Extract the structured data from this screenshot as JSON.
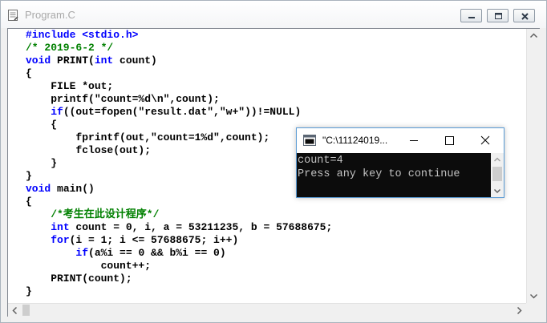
{
  "editor": {
    "title": "Program.C",
    "title_icon": "document-icon",
    "code_lines": [
      [
        {
          "t": "#include <stdio.h>",
          "c": "pp"
        }
      ],
      [
        {
          "t": "/* 2019-6-2 */",
          "c": "cm"
        }
      ],
      [
        {
          "t": "void",
          "c": "kw"
        },
        {
          "t": " PRINT(",
          "c": "tx"
        },
        {
          "t": "int",
          "c": "kw"
        },
        {
          "t": " count)",
          "c": "tx"
        }
      ],
      [
        {
          "t": "{",
          "c": "tx"
        }
      ],
      [
        {
          "t": "    FILE *out;",
          "c": "tx"
        }
      ],
      [
        {
          "t": "    printf(\"count=%d\\n\",count);",
          "c": "tx"
        }
      ],
      [
        {
          "t": "    ",
          "c": "tx"
        },
        {
          "t": "if",
          "c": "kw"
        },
        {
          "t": "((out=fopen(\"result.dat\",\"w+\"))!=NULL)",
          "c": "tx"
        }
      ],
      [
        {
          "t": "    {",
          "c": "tx"
        }
      ],
      [
        {
          "t": "        fprintf(out,\"count=1%d\",count);",
          "c": "tx"
        }
      ],
      [
        {
          "t": "        fclose(out);",
          "c": "tx"
        }
      ],
      [
        {
          "t": "    }",
          "c": "tx"
        }
      ],
      [
        {
          "t": "}",
          "c": "tx"
        }
      ],
      [
        {
          "t": "void",
          "c": "kw"
        },
        {
          "t": " main()",
          "c": "tx"
        }
      ],
      [
        {
          "t": "{",
          "c": "tx"
        }
      ],
      [
        {
          "t": "    /*考生在此设计程序*/",
          "c": "cm"
        }
      ],
      [
        {
          "t": "    ",
          "c": "tx"
        },
        {
          "t": "int",
          "c": "kw"
        },
        {
          "t": " count = 0, i, a = 53211235, b = 57688675;",
          "c": "tx"
        }
      ],
      [
        {
          "t": "    ",
          "c": "tx"
        },
        {
          "t": "for",
          "c": "kw"
        },
        {
          "t": "(i = 1; i <= 57688675; i++)",
          "c": "tx"
        }
      ],
      [
        {
          "t": "        ",
          "c": "tx"
        },
        {
          "t": "if",
          "c": "kw"
        },
        {
          "t": "(a%i == 0 && b%i == 0)",
          "c": "tx"
        }
      ],
      [
        {
          "t": "            count++;",
          "c": "tx"
        }
      ],
      [
        {
          "t": "    PRINT(count);",
          "c": "tx"
        }
      ],
      [
        {
          "t": "}",
          "c": "tx"
        }
      ]
    ],
    "colors": {
      "keyword": "#0000ff",
      "comment": "#008000",
      "text": "#000000"
    }
  },
  "console": {
    "title": "\"C:\\11124019...",
    "output_lines": [
      "count=4",
      "Press any key to continue"
    ],
    "colors": {
      "background": "#0c0c0c",
      "text": "#c0c0c0"
    }
  }
}
